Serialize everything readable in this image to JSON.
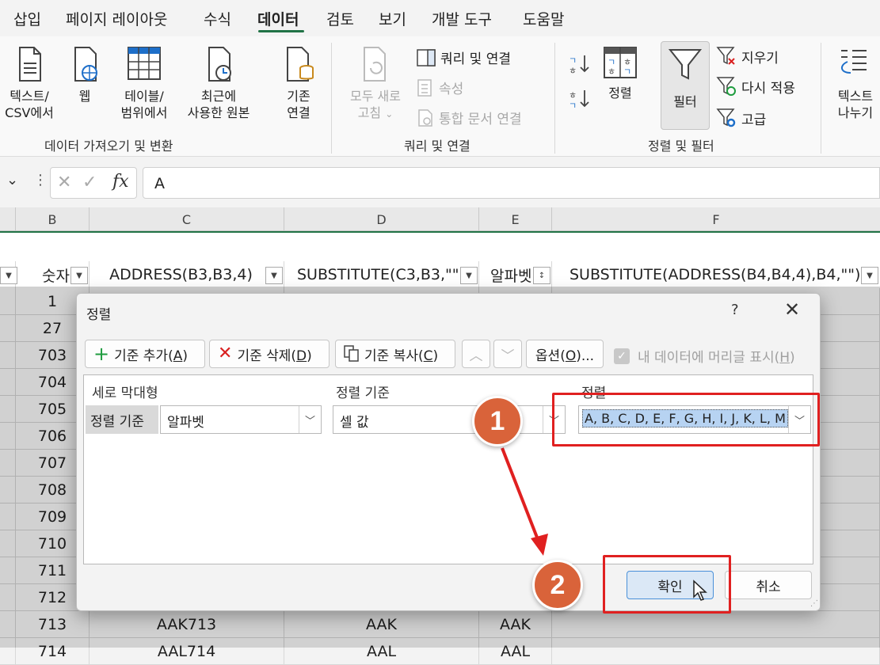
{
  "menu": {
    "tabs": [
      "삽입",
      "페이지 레이아웃",
      "수식",
      "데이터",
      "검토",
      "보기",
      "개발 도구",
      "도움말"
    ],
    "active": "데이터"
  },
  "ribbon": {
    "get_data": {
      "text_csv": [
        "텍스트/",
        "CSV에서"
      ],
      "web": "웹",
      "table_range": [
        "테이블/",
        "범위에서"
      ],
      "recent_sources": [
        "최근에",
        "사용한 원본"
      ],
      "existing_conn": [
        "기존",
        "연결"
      ],
      "group_label": "데이터 가져오기 및 변환"
    },
    "queries": {
      "refresh_all": [
        "모두 새로",
        "고침"
      ],
      "queries_connections": "쿼리 및 연결",
      "properties": "속성",
      "edit_links": "통합 문서 연결",
      "group_label": "쿼리 및 연결"
    },
    "sort_filter": {
      "sort": "정렬",
      "filter": "필터",
      "clear": "지우기",
      "reapply": "다시 적용",
      "advanced": "고급",
      "group_label": "정렬 및 필터"
    },
    "data_tools": {
      "text_to_columns": [
        "텍스트",
        "나누기"
      ]
    }
  },
  "formula_bar": {
    "value": "A",
    "fx": "fx"
  },
  "columns": [
    "B",
    "C",
    "D",
    "E",
    "F"
  ],
  "header_row": {
    "b": "숫자",
    "c": "ADDRESS(B3,B3,4)",
    "d": "SUBSTITUTE(C3,B3,\"\"",
    "e": "알파벳",
    "f": "SUBSTITUTE(ADDRESS(B4,B4,4),B4,\"\")"
  },
  "rows": [
    {
      "b": "1",
      "c": "",
      "d": "",
      "e": ""
    },
    {
      "b": "27",
      "c": "",
      "d": "",
      "e": ""
    },
    {
      "b": "703",
      "c": "",
      "d": "",
      "e": ""
    },
    {
      "b": "704",
      "c": "",
      "d": "",
      "e": ""
    },
    {
      "b": "705",
      "c": "",
      "d": "",
      "e": ""
    },
    {
      "b": "706",
      "c": "",
      "d": "",
      "e": ""
    },
    {
      "b": "707",
      "c": "",
      "d": "",
      "e": ""
    },
    {
      "b": "708",
      "c": "",
      "d": "",
      "e": ""
    },
    {
      "b": "709",
      "c": "",
      "d": "",
      "e": ""
    },
    {
      "b": "710",
      "c": "",
      "d": "",
      "e": ""
    },
    {
      "b": "711",
      "c": "",
      "d": "",
      "e": ""
    },
    {
      "b": "712",
      "c": "",
      "d": "",
      "e": ""
    },
    {
      "b": "713",
      "c": "AAK713",
      "d": "AAK",
      "e": "AAK"
    },
    {
      "b": "714",
      "c": "AAL714",
      "d": "AAL",
      "e": "AAL"
    }
  ],
  "dialog": {
    "title": "정렬",
    "help": "?",
    "add_level": "기준 추가(",
    "add_level_key": "A",
    "delete_level": "기준 삭제(",
    "delete_level_key": "D",
    "copy_level": "기준 복사(",
    "copy_level_key": "C",
    "options": "옵션(",
    "options_key": "O",
    "options_suffix": ")...",
    "has_headers": "내 데이터에 머리글 표시(",
    "has_headers_key": "H",
    "col_header": "세로 막대형",
    "sort_on_header": "정렬 기준",
    "order_header": "정렬",
    "row_label": "정렬 기준",
    "column_value": "알파벳",
    "sort_on_value": "셀 값",
    "order_value": "A, B, C, D, E, F, G, H, I, J, K, L, M",
    "ok": "확인",
    "cancel": "취소"
  },
  "annotations": {
    "step1": "1",
    "step2": "2",
    "accent": "#e02020",
    "badge_color": "#d9633a"
  }
}
